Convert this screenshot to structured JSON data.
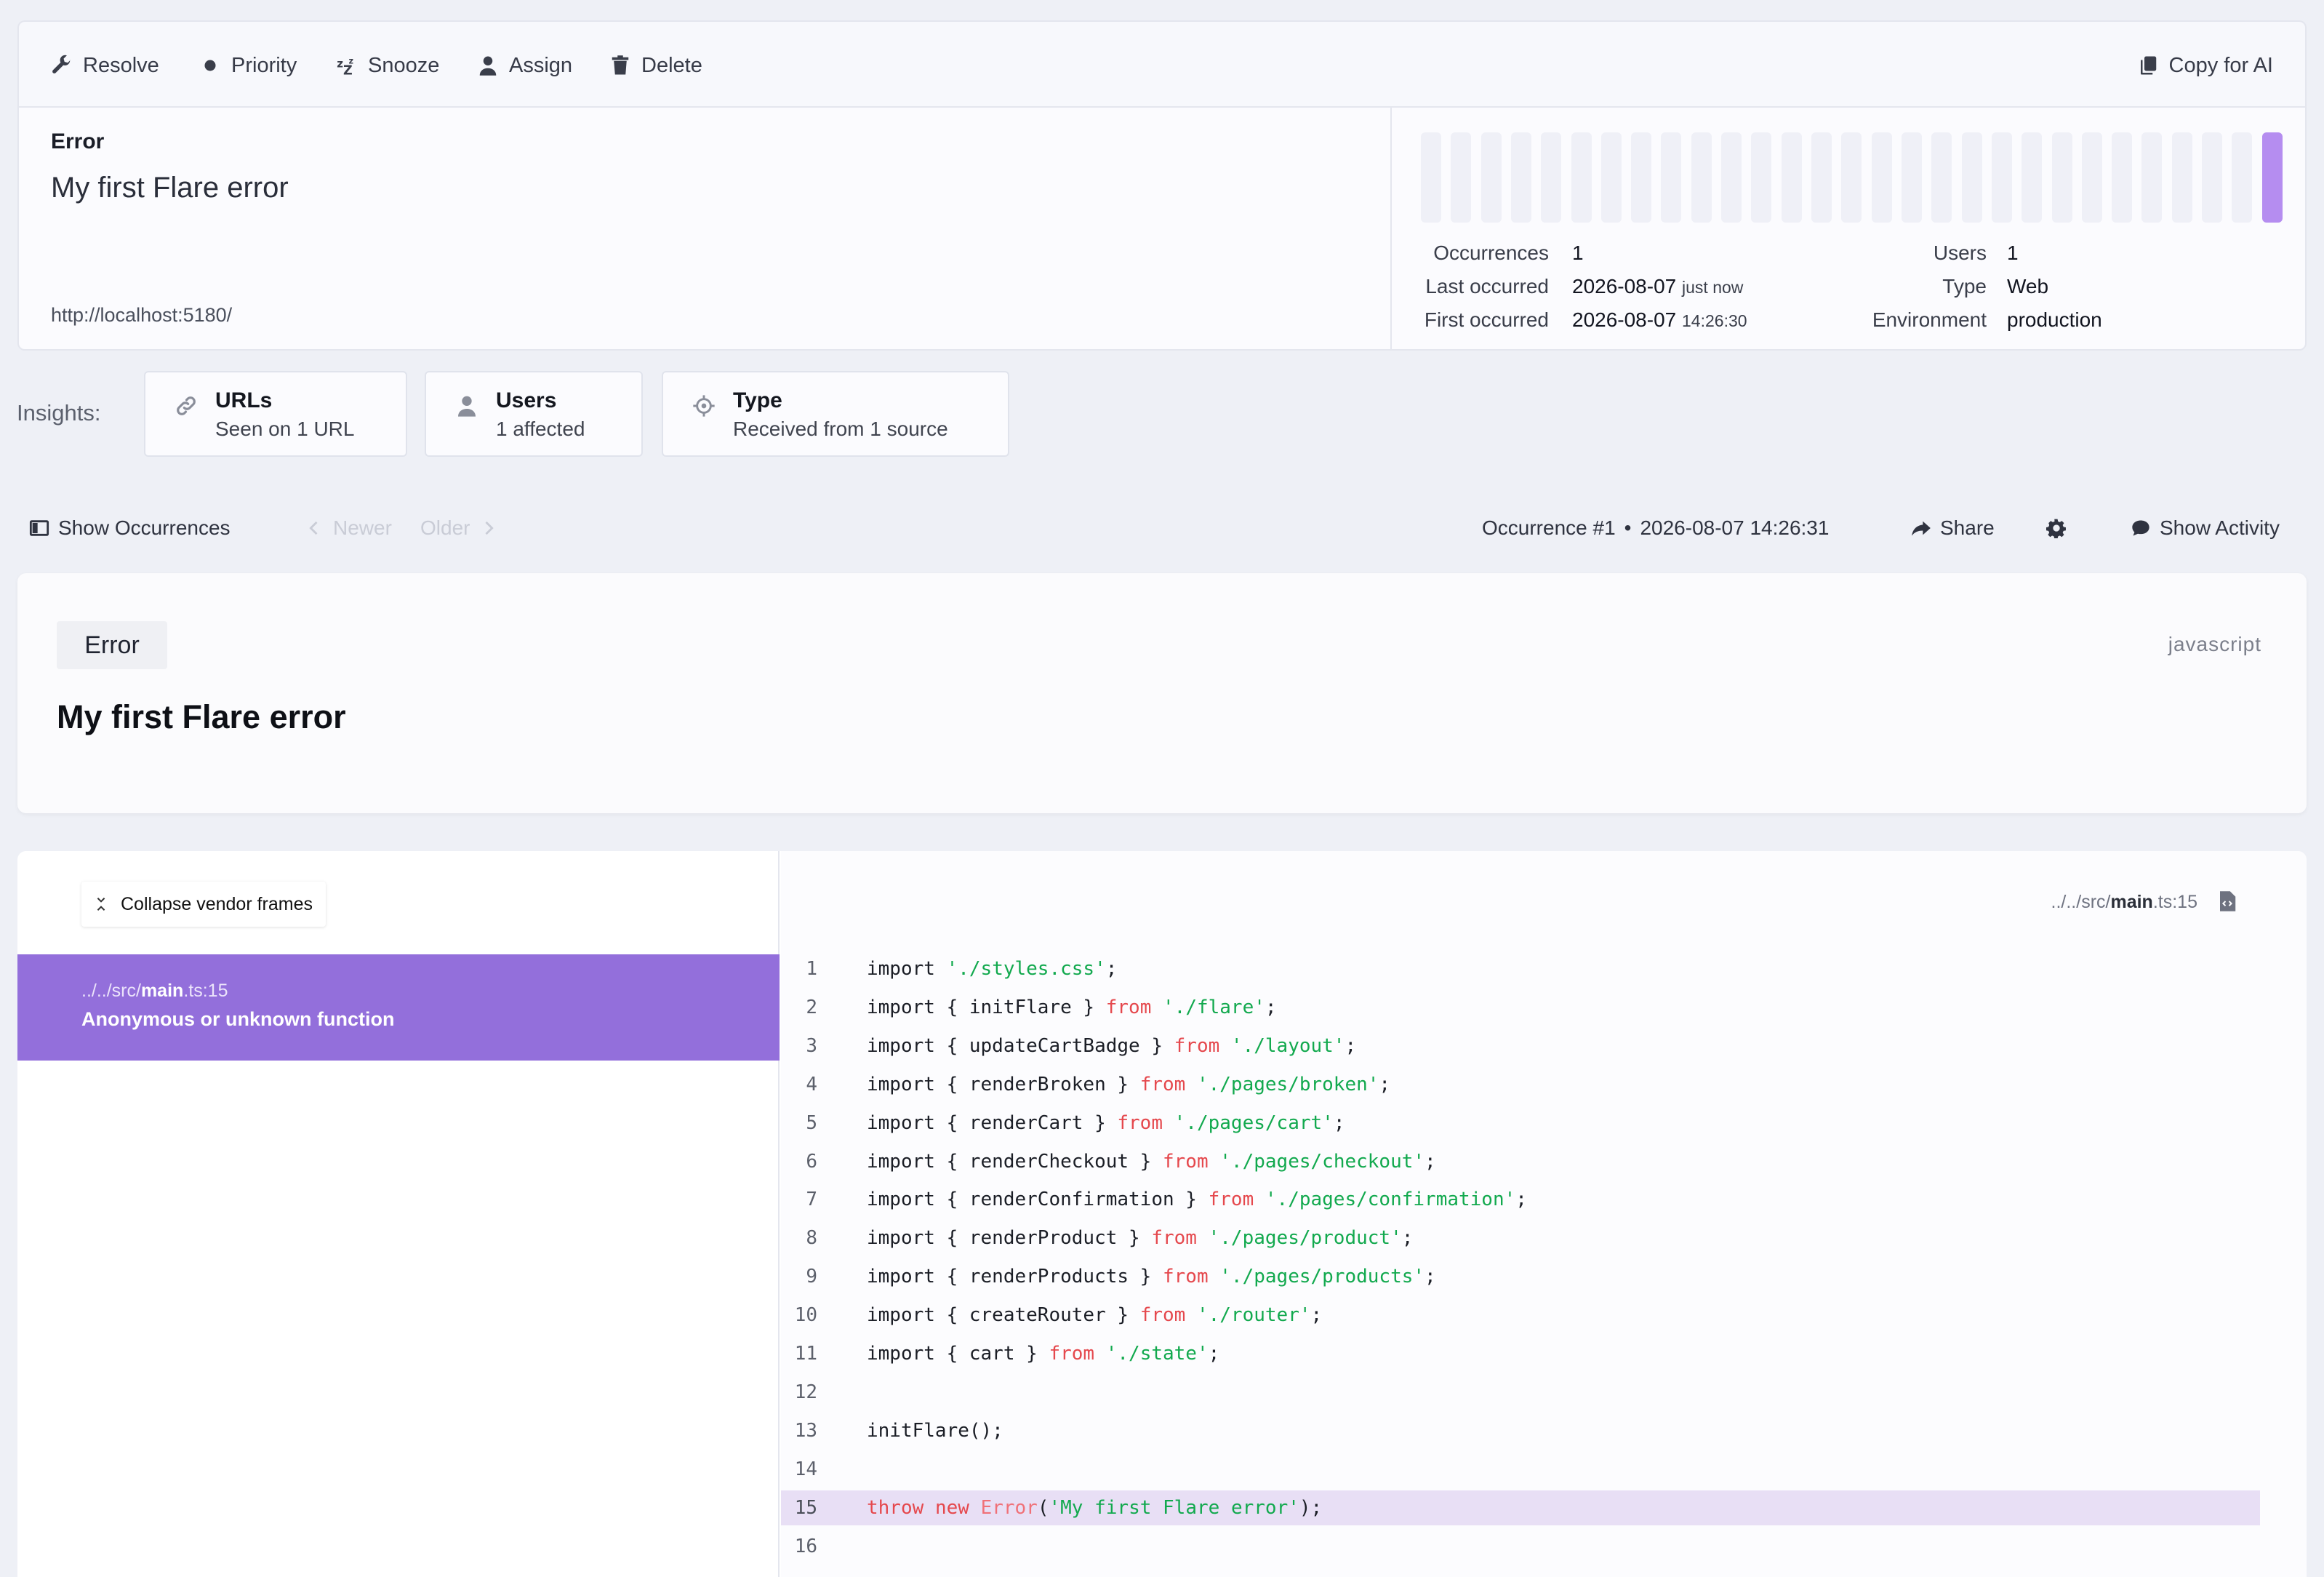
{
  "toolbar": {
    "resolve": "Resolve",
    "priority": "Priority",
    "snooze": "Snooze",
    "assign": "Assign",
    "delete": "Delete",
    "copy_ai": "Copy for AI"
  },
  "summary": {
    "label": "Error",
    "title": "My first Flare error",
    "url": "http://localhost:5180/",
    "occurrence_bars": {
      "count": 29,
      "active_index": 28,
      "active_color": "#b58df0"
    },
    "stats": {
      "occurrences_label": "Occurrences",
      "occurrences": "1",
      "last_occurred_label": "Last occurred",
      "last_occurred_date": "2026-08-07",
      "last_occurred_rel": "just now",
      "first_occurred_label": "First occurred",
      "first_occurred_date": "2026-08-07",
      "first_occurred_time": "14:26:30",
      "users_label": "Users",
      "users": "1",
      "type_label": "Type",
      "type": "Web",
      "environment_label": "Environment",
      "environment": "production"
    }
  },
  "insights": {
    "label": "Insights:",
    "cards": [
      {
        "icon": "link-icon",
        "title": "URLs",
        "subtitle": "Seen on 1 URL"
      },
      {
        "icon": "user-icon",
        "title": "Users",
        "subtitle": "1 affected"
      },
      {
        "icon": "crosshair-icon",
        "title": "Type",
        "subtitle": "Received from 1 source"
      }
    ]
  },
  "occurrence_nav": {
    "show_occurrences": "Show Occurrences",
    "newer": "Newer",
    "older": "Older",
    "occurrence": "Occurrence #1",
    "occurrence_time": "2026-08-07 14:26:31",
    "share": "Share",
    "show_activity": "Show Activity"
  },
  "error": {
    "badge": "Error",
    "language": "javascript",
    "message": "My first Flare error"
  },
  "stack": {
    "collapse_label": "Collapse vendor frames",
    "frame": {
      "path_prefix": "../../src/",
      "file": "main",
      "ext": ".ts",
      "line": ":15",
      "function": "Anonymous or unknown function"
    },
    "file_header": {
      "prefix": "../../src/",
      "file": "main",
      "ext": ".ts",
      "line": ":15"
    },
    "highlight_line": 15,
    "colors": {
      "keyword": "#e5484d",
      "string": "#12a94e",
      "plain": "#1b1e26"
    },
    "lines": [
      {
        "n": 1,
        "tokens": [
          [
            "p",
            "import "
          ],
          [
            "s",
            "'./styles.css'"
          ],
          [
            "p",
            ";"
          ]
        ]
      },
      {
        "n": 2,
        "tokens": [
          [
            "p",
            "import { initFlare } "
          ],
          [
            "k",
            "from"
          ],
          [
            "p",
            " "
          ],
          [
            "s",
            "'./flare'"
          ],
          [
            "p",
            ";"
          ]
        ]
      },
      {
        "n": 3,
        "tokens": [
          [
            "p",
            "import { updateCartBadge } "
          ],
          [
            "k",
            "from"
          ],
          [
            "p",
            " "
          ],
          [
            "s",
            "'./layout'"
          ],
          [
            "p",
            ";"
          ]
        ]
      },
      {
        "n": 4,
        "tokens": [
          [
            "p",
            "import { renderBroken } "
          ],
          [
            "k",
            "from"
          ],
          [
            "p",
            " "
          ],
          [
            "s",
            "'./pages/broken'"
          ],
          [
            "p",
            ";"
          ]
        ]
      },
      {
        "n": 5,
        "tokens": [
          [
            "p",
            "import { renderCart } "
          ],
          [
            "k",
            "from"
          ],
          [
            "p",
            " "
          ],
          [
            "s",
            "'./pages/cart'"
          ],
          [
            "p",
            ";"
          ]
        ]
      },
      {
        "n": 6,
        "tokens": [
          [
            "p",
            "import { renderCheckout } "
          ],
          [
            "k",
            "from"
          ],
          [
            "p",
            " "
          ],
          [
            "s",
            "'./pages/checkout'"
          ],
          [
            "p",
            ";"
          ]
        ]
      },
      {
        "n": 7,
        "tokens": [
          [
            "p",
            "import { renderConfirmation } "
          ],
          [
            "k",
            "from"
          ],
          [
            "p",
            " "
          ],
          [
            "s",
            "'./pages/confirmation'"
          ],
          [
            "p",
            ";"
          ]
        ]
      },
      {
        "n": 8,
        "tokens": [
          [
            "p",
            "import { renderProduct } "
          ],
          [
            "k",
            "from"
          ],
          [
            "p",
            " "
          ],
          [
            "s",
            "'./pages/product'"
          ],
          [
            "p",
            ";"
          ]
        ]
      },
      {
        "n": 9,
        "tokens": [
          [
            "p",
            "import { renderProducts } "
          ],
          [
            "k",
            "from"
          ],
          [
            "p",
            " "
          ],
          [
            "s",
            "'./pages/products'"
          ],
          [
            "p",
            ";"
          ]
        ]
      },
      {
        "n": 10,
        "tokens": [
          [
            "p",
            "import { createRouter } "
          ],
          [
            "k",
            "from"
          ],
          [
            "p",
            " "
          ],
          [
            "s",
            "'./router'"
          ],
          [
            "p",
            ";"
          ]
        ]
      },
      {
        "n": 11,
        "tokens": [
          [
            "p",
            "import { cart } "
          ],
          [
            "k",
            "from"
          ],
          [
            "p",
            " "
          ],
          [
            "s",
            "'./state'"
          ],
          [
            "p",
            ";"
          ]
        ]
      },
      {
        "n": 12,
        "tokens": []
      },
      {
        "n": 13,
        "tokens": [
          [
            "p",
            "initFlare();"
          ]
        ]
      },
      {
        "n": 14,
        "tokens": []
      },
      {
        "n": 15,
        "tokens": [
          [
            "k",
            "throw"
          ],
          [
            "p",
            " "
          ],
          [
            "k",
            "new"
          ],
          [
            "p",
            " "
          ],
          [
            "e",
            "Error"
          ],
          [
            "p",
            "("
          ],
          [
            "s",
            "'My first Flare error'"
          ],
          [
            "p",
            ");"
          ]
        ]
      },
      {
        "n": 16,
        "tokens": []
      }
    ]
  }
}
